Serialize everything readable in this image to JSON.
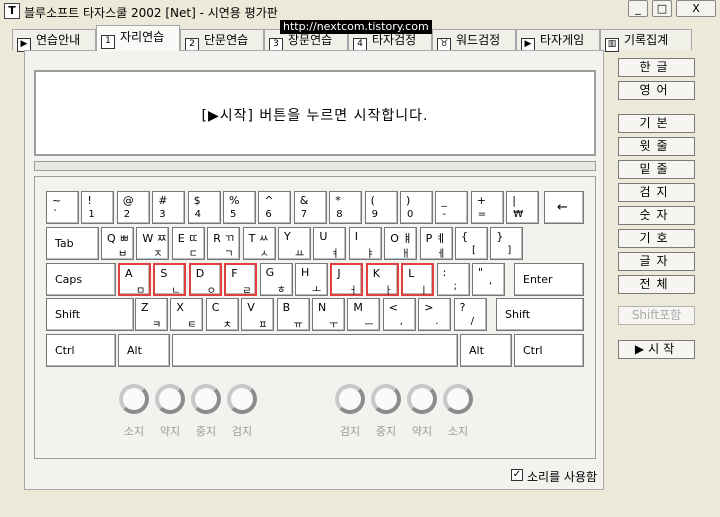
{
  "window": {
    "title": "블루소프트 타자스쿨 2002 [Net] - 시연용 평가판",
    "icon_letter": "T",
    "watermark": "http://nextcom.tistory.com",
    "buttons": [
      "_",
      "□",
      "X"
    ]
  },
  "tabs": [
    {
      "icon": "▶",
      "label": "연습안내"
    },
    {
      "icon": "1",
      "label": "자리연습"
    },
    {
      "icon": "2",
      "label": "단문연습"
    },
    {
      "icon": "3",
      "label": "장문연습"
    },
    {
      "icon": "4",
      "label": "타자검정"
    },
    {
      "icon": "♉",
      "label": "워드검정"
    },
    {
      "icon": "▶",
      "label": "타자게임"
    },
    {
      "icon": "▥",
      "label": "기록집계"
    }
  ],
  "active_tab": 1,
  "message": "[▶시작] 버튼을 누르면 시작합니다.",
  "keyboard": {
    "row1": [
      {
        "t": "~",
        "b": "`"
      },
      {
        "t": "!",
        "b": "1"
      },
      {
        "t": "@",
        "b": "2"
      },
      {
        "t": "#",
        "b": "3"
      },
      {
        "t": "$",
        "b": "4"
      },
      {
        "t": "%",
        "b": "5"
      },
      {
        "t": "^",
        "b": "6"
      },
      {
        "t": "&",
        "b": "7"
      },
      {
        "t": "*",
        "b": "8"
      },
      {
        "t": "(",
        "b": "9"
      },
      {
        "t": ")",
        "b": "0"
      },
      {
        "t": "_",
        "b": "-"
      },
      {
        "t": "+",
        "b": "="
      },
      {
        "t": "|",
        "b": "₩"
      },
      {
        "c": "←"
      }
    ],
    "row2": [
      {
        "c": "Tab"
      },
      {
        "t": "Q ㅃ",
        "b": "ㅂ"
      },
      {
        "t": "W ㅉ",
        "b": "ㅈ"
      },
      {
        "t": "E ㄸ",
        "b": "ㄷ"
      },
      {
        "t": "R ㄲ",
        "b": "ㄱ"
      },
      {
        "t": "T ㅆ",
        "b": "ㅅ"
      },
      {
        "t": "Y",
        "b": "ㅛ"
      },
      {
        "t": "U",
        "b": "ㅕ"
      },
      {
        "t": "I",
        "b": "ㅑ"
      },
      {
        "t": "O ㅒ",
        "b": "ㅐ"
      },
      {
        "t": "P ㅖ",
        "b": "ㅔ"
      },
      {
        "t": "{",
        "b": "["
      },
      {
        "t": "}",
        "b": "]"
      }
    ],
    "row3": [
      {
        "c": "Caps"
      },
      {
        "t": "A",
        "b": "ㅁ"
      },
      {
        "t": "S",
        "b": "ㄴ"
      },
      {
        "t": "D",
        "b": "ㅇ"
      },
      {
        "t": "F",
        "b": "ㄹ"
      },
      {
        "t": "G",
        "b": "ㅎ"
      },
      {
        "t": "H",
        "b": "ㅗ"
      },
      {
        "t": "J",
        "b": "ㅓ"
      },
      {
        "t": "K",
        "b": "ㅏ"
      },
      {
        "t": "L",
        "b": "ㅣ"
      },
      {
        "t": ":",
        "b": ";"
      },
      {
        "t": "\"",
        "b": "'"
      },
      {
        "c": "Enter"
      }
    ],
    "row4": [
      {
        "c": "Shift"
      },
      {
        "t": "Z",
        "b": "ㅋ"
      },
      {
        "t": "X",
        "b": "ㅌ"
      },
      {
        "t": "C",
        "b": "ㅊ"
      },
      {
        "t": "V",
        "b": "ㅍ"
      },
      {
        "t": "B",
        "b": "ㅠ"
      },
      {
        "t": "N",
        "b": "ㅜ"
      },
      {
        "t": "M",
        "b": "ㅡ"
      },
      {
        "t": "<",
        "b": ","
      },
      {
        "t": ">",
        "b": "."
      },
      {
        "t": "?",
        "b": "/"
      },
      {
        "c": "Shift"
      }
    ],
    "row5": [
      {
        "c": "Ctrl"
      },
      {
        "c": "Alt"
      },
      {
        "c": ""
      },
      {
        "c": "Alt"
      },
      {
        "c": "Ctrl"
      }
    ]
  },
  "fingers": {
    "left": [
      "소지",
      "약지",
      "중지",
      "검지"
    ],
    "right": [
      "검지",
      "중지",
      "약지",
      "소지"
    ]
  },
  "sound": {
    "label": "소리를 사용함",
    "checked": true
  },
  "right_buttons": [
    "한글",
    "영어",
    "기본",
    "윗줄",
    "밑줄",
    "검지",
    "숫자",
    "기호",
    "글자",
    "전체"
  ],
  "shift_button": "Shift포함",
  "start_button": "▶시작"
}
